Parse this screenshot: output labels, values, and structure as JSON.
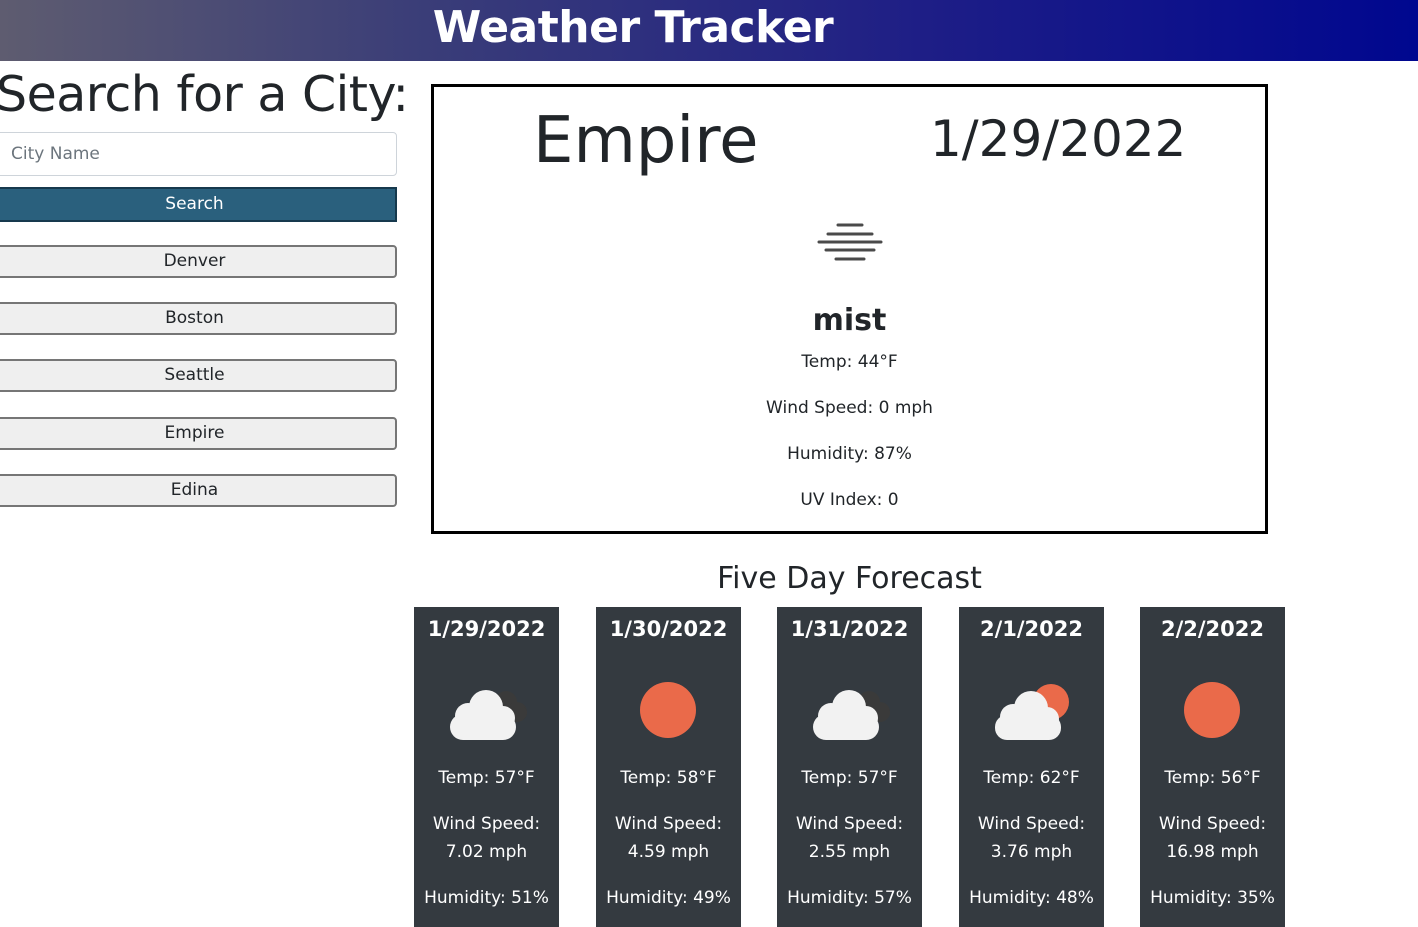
{
  "header": {
    "title": "Weather Tracker"
  },
  "sidebar": {
    "title": "Search for a City:",
    "input_placeholder": "City Name",
    "input_value": "",
    "search_label": "Search",
    "history": [
      "Denver",
      "Boston",
      "Seattle",
      "Empire",
      "Edina"
    ]
  },
  "current": {
    "city": "Empire",
    "date": "1/29/2022",
    "icon": "mist-icon",
    "description": "mist",
    "temp": "Temp: 44°F",
    "wind": "Wind Speed: 0 mph",
    "humidity": "Humidity: 87%",
    "uv": "UV Index: 0"
  },
  "forecast": {
    "heading": "Five Day Forecast",
    "days": [
      {
        "date": "1/29/2022",
        "icon": "overcast-clouds-icon",
        "temp": "Temp: 57°F",
        "wind_label": "Wind Speed:",
        "wind_value": "7.02 mph",
        "humidity": "Humidity: 51%"
      },
      {
        "date": "1/30/2022",
        "icon": "sun-icon",
        "temp": "Temp: 58°F",
        "wind_label": "Wind Speed:",
        "wind_value": "4.59 mph",
        "humidity": "Humidity: 49%"
      },
      {
        "date": "1/31/2022",
        "icon": "overcast-clouds-icon",
        "temp": "Temp: 57°F",
        "wind_label": "Wind Speed:",
        "wind_value": "2.55 mph",
        "humidity": "Humidity: 57%"
      },
      {
        "date": "2/1/2022",
        "icon": "partly-cloudy-icon",
        "temp": "Temp: 62°F",
        "wind_label": "Wind Speed:",
        "wind_value": "3.76 mph",
        "humidity": "Humidity: 48%"
      },
      {
        "date": "2/2/2022",
        "icon": "sun-icon",
        "temp": "Temp: 56°F",
        "wind_label": "Wind Speed:",
        "wind_value": "16.98 mph",
        "humidity": "Humidity: 35%"
      }
    ]
  },
  "colors": {
    "header_gradient_start": "#5e5c70",
    "header_gradient_end": "#00078f",
    "search_button": "#2a607d",
    "forecast_card": "#343a40",
    "sun": "#ea6a4a",
    "cloud_light": "#f2f2f2",
    "cloud_dark": "#3a3a3a"
  }
}
